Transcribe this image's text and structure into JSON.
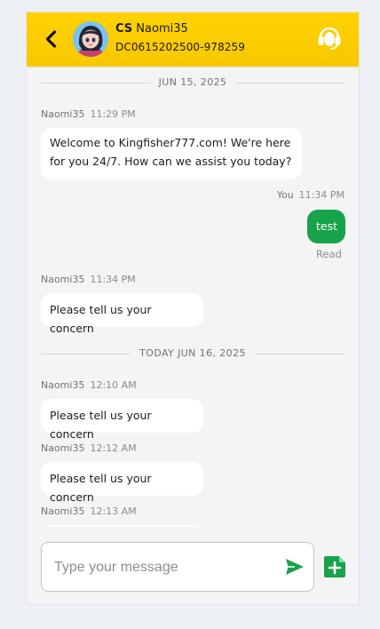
{
  "header": {
    "agent_prefix": "CS",
    "agent_name": "Naomi35",
    "ticket_id": "DC0615202500-978259"
  },
  "messages": {
    "date_1": "JUN 15, 2025",
    "m1": {
      "sender": "Naomi35",
      "time": "11:29 PM",
      "text": "Welcome to Kingfisher777.com! We're here for you 24/7. How can we assist you today?"
    },
    "m2": {
      "sender": "You",
      "time": "11:34 PM",
      "text": "test",
      "status": "Read"
    },
    "m3": {
      "sender": "Naomi35",
      "time": "11:34 PM",
      "text": "Please tell us your concern"
    },
    "date_2": "TODAY JUN 16, 2025",
    "m4": {
      "sender": "Naomi35",
      "time": "12:10 AM",
      "text": "Please tell us your concern"
    },
    "m5": {
      "sender": "Naomi35",
      "time": "12:12 AM",
      "text": "Please tell us your concern"
    },
    "m6": {
      "sender": "Naomi35",
      "time": "12:13 AM"
    }
  },
  "composer": {
    "placeholder": "Type your message"
  },
  "icons": {
    "back": "chevron-left-icon",
    "support": "headset-icon",
    "send": "send-icon",
    "attach": "add-file-icon"
  },
  "colors": {
    "header": "#ffd200",
    "accent_green": "#16a34a",
    "background": "#edf1f6"
  }
}
